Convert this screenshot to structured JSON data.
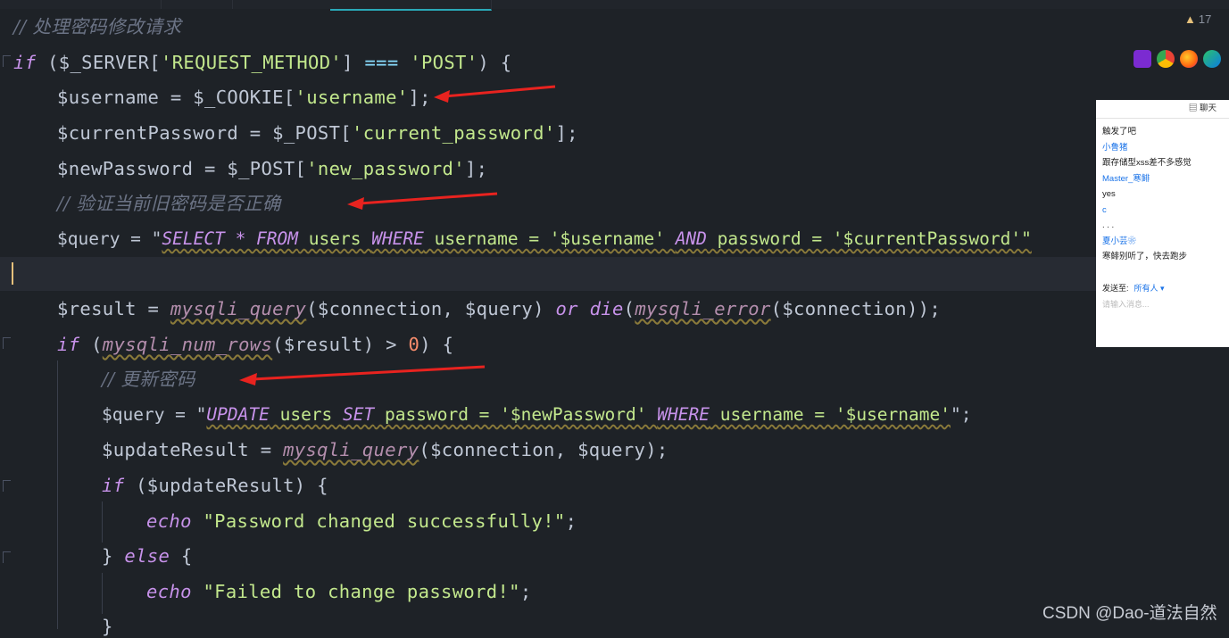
{
  "editor": {
    "warning_count": "17",
    "lines": {
      "c1": "// 处理密码修改请求",
      "c2": "// 验证当前旧密码是否正确",
      "c3": "// 更新密码",
      "l1_if": "if",
      "l1_rest_a": " ($_SERVER[",
      "l1_str": "'REQUEST_METHOD'",
      "l1_rest_b": "] ",
      "l1_op": "===",
      "l1_str2": " 'POST'",
      "l1_rest_c": ") {",
      "l2_a": "$username = $_COOKIE[",
      "l2_str": "'username'",
      "l2_b": "];",
      "l3_a": "$currentPassword = $_POST[",
      "l3_str": "'current_password'",
      "l3_b": "];",
      "l4_a": "$newPassword = $_POST[",
      "l4_str": "'new_password'",
      "l4_b": "];",
      "l6_a": "$query = \"",
      "l6_k1": "SELECT * FROM",
      "l6_t1": " users ",
      "l6_k2": "WHERE",
      "l6_t2": " username = '$username' ",
      "l6_k3": "AND",
      "l6_t3": " password = '$currentPassword'\"",
      "l8_a": "$result = ",
      "l8_f1": "mysqli_query",
      "l8_b": "($connection, $query) ",
      "l8_or": "or",
      "l8_sp": " ",
      "l8_die": "die",
      "l8_c": "(",
      "l8_f2": "mysqli_error",
      "l8_d": "($connection));",
      "l9_if": "if",
      "l9_a": " (",
      "l9_f": "mysqli_num_rows",
      "l9_b": "($result) > ",
      "l9_num": "0",
      "l9_c": ") {",
      "l11_a": "$query = \"",
      "l11_k1": "UPDATE",
      "l11_t1": " users ",
      "l11_k2": "SET",
      "l11_t2": " password = '$newPassword' ",
      "l11_k3": "WHERE",
      "l11_t3": " username = '$username'",
      "l11_b": "\";",
      "l12_a": "$updateResult = ",
      "l12_f": "mysqli_query",
      "l12_b": "($connection, $query);",
      "l13_if": "if",
      "l13_a": " ($updateResult) {",
      "l14_echo": "echo",
      "l14_str": " \"Password changed successfully!\"",
      "l14_b": ";",
      "l15_a": "} ",
      "l15_else": "else",
      "l15_b": " {",
      "l16_echo": "echo",
      "l16_str": " \"Failed to change password!\"",
      "l16_b": ";",
      "l17": "}"
    }
  },
  "browsers": [
    "phpstorm-icon",
    "chrome-icon",
    "firefox-icon",
    "edge-icon"
  ],
  "chat": {
    "header": "聊天",
    "messages": [
      {
        "text": "触发了吧",
        "type": "msg"
      },
      {
        "text": "小鲁猪",
        "type": "sender"
      },
      {
        "text": "跟存储型xss差不多感觉",
        "type": "msg"
      },
      {
        "text": "Master_寒鲱",
        "type": "sender"
      },
      {
        "text": "yes",
        "type": "msg"
      },
      {
        "text": "c",
        "type": "sender"
      },
      {
        "text": ". . .",
        "type": "msg"
      },
      {
        "text": "夏小芸❀",
        "type": "sender"
      },
      {
        "text": "寒鲱别听了，快去跑步",
        "type": "msg"
      }
    ],
    "send_to_label": "发送至:",
    "send_to_value": "所有人 ▾",
    "input_placeholder": "请输入消息..."
  },
  "watermark": "CSDN @Dao-道法自然",
  "colors": {
    "arrow": "#e8231f",
    "accent": "#2aa9b8"
  }
}
